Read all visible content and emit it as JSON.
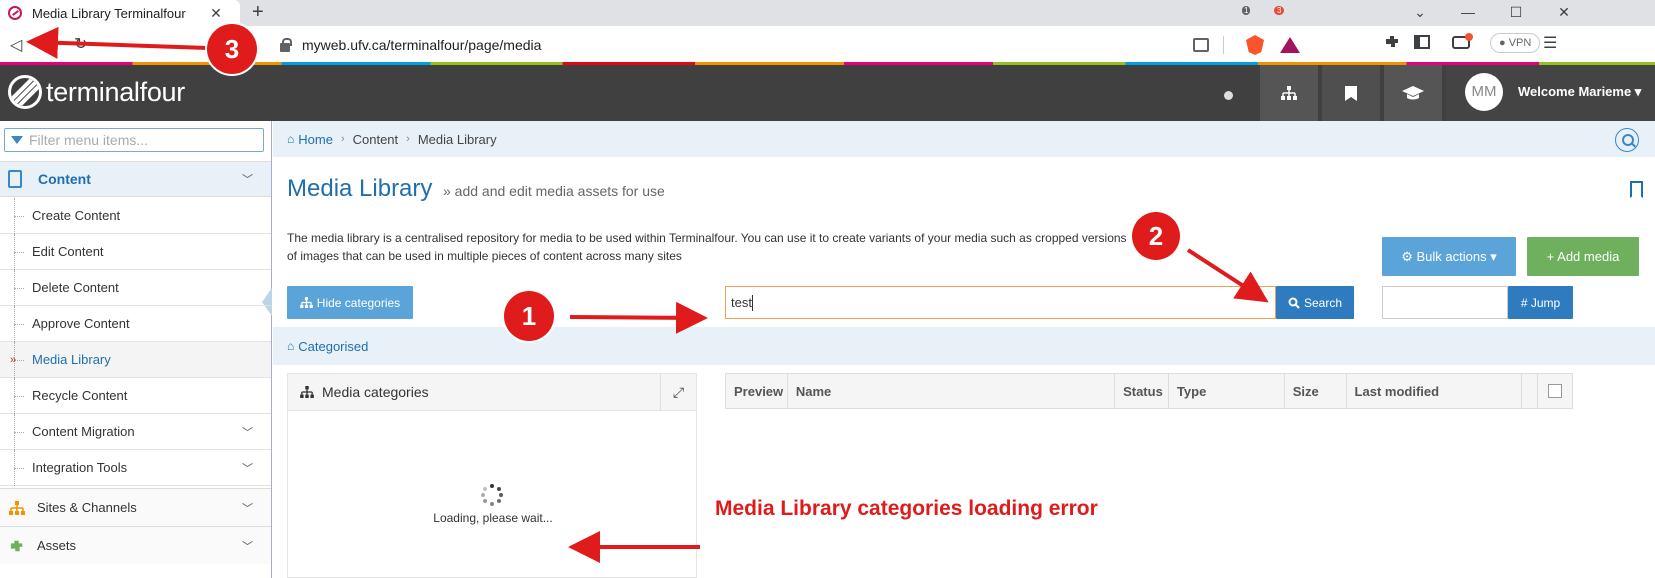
{
  "browser": {
    "tab_title": "Media Library Terminalfour",
    "tab_close": "✕",
    "new_tab": "+",
    "url": "myweb.ufv.ca/terminalfour/page/media",
    "brave_badge": "1",
    "rewards_badge": "3",
    "vpn_label": "VPN"
  },
  "header": {
    "logo_text": "terminalfour",
    "avatar_initials": "MM",
    "welcome": "Welcome Marieme ▾"
  },
  "sidebar": {
    "filter_placeholder": "Filter menu items...",
    "content_label": "Content",
    "items": [
      {
        "label": "Create Content"
      },
      {
        "label": "Edit Content"
      },
      {
        "label": "Delete Content"
      },
      {
        "label": "Approve Content"
      },
      {
        "label": "Media Library"
      },
      {
        "label": "Recycle Content"
      },
      {
        "label": "Content Migration"
      },
      {
        "label": "Integration Tools"
      }
    ],
    "groups": [
      {
        "label": "Sites & Channels"
      },
      {
        "label": "Assets"
      }
    ]
  },
  "breadcrumb": {
    "home": "Home",
    "content": "Content",
    "current": "Media Library"
  },
  "page": {
    "title": "Media Library",
    "subtitle": "» add and edit media assets for use",
    "description": "The media library is a centralised repository for media to be used within Terminalfour. You can use it to create variants of your media such as cropped versions of images that can be used in multiple pieces of content across many sites"
  },
  "actions": {
    "bulk": "⚙ Bulk actions ▾",
    "add_media": "+ Add media",
    "hide_categories": "Hide categories",
    "search_value": "test",
    "search_btn": "Search",
    "jump_btn": "# Jump"
  },
  "categorised": "Categorised",
  "categories_panel": {
    "title": "Media categories",
    "expand": "⤢",
    "loading": "Loading, please wait..."
  },
  "table": {
    "columns": [
      "Preview",
      "Name",
      "Status",
      "Type",
      "Size",
      "Last modified"
    ]
  },
  "annotations": {
    "one": "1",
    "two": "2",
    "three": "3",
    "error_text": "Media Library categories loading error"
  },
  "colors": {
    "brand_blue": "#1f6fae",
    "annotation_red": "#e01b1b",
    "header_dark": "#404040"
  }
}
